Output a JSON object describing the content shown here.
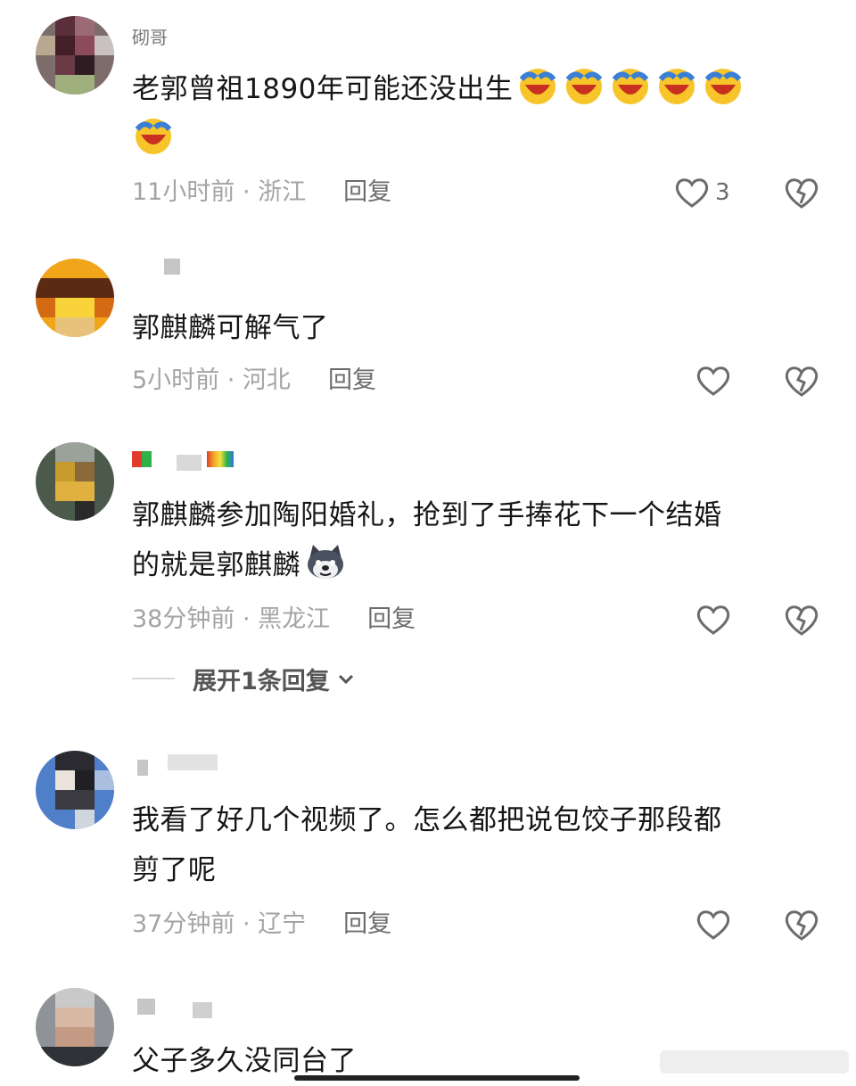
{
  "colors": {
    "meta_text": "#a4a4a4",
    "reply_text": "#6c6c6c",
    "body_text": "#161616",
    "background": "#ffffff"
  },
  "comments": [
    {
      "username": "砌哥",
      "text": "老郭曾祖1890年可能还没出生",
      "emoji": "rolling-on-floor-laughing-emoji x6",
      "time": "11小时前",
      "location": "浙江",
      "reply_label": "回复",
      "like_count": "3"
    },
    {
      "username": "",
      "text": "郭麒麟可解气了",
      "time": "5小时前",
      "location": "河北",
      "reply_label": "回复",
      "like_count": ""
    },
    {
      "username": "",
      "text_line1": "郭麒麟参加陶阳婚礼，抢到了手捧花下一个结婚",
      "text_line2": "的就是郭麒麟",
      "emoji": "husky-dog-emoji",
      "time": "38分钟前",
      "location": "黑龙江",
      "reply_label": "回复",
      "like_count": "",
      "expand_label": "展开1条回复"
    },
    {
      "username": "",
      "text_line1": "我看了好几个视频了。怎么都把说包饺子那段都",
      "text_line2": "剪了呢",
      "time": "37分钟前",
      "location": "辽宁",
      "reply_label": "回复",
      "like_count": ""
    },
    {
      "username": "",
      "text": "父子多久没同台了"
    }
  ],
  "meta_separator": " · "
}
